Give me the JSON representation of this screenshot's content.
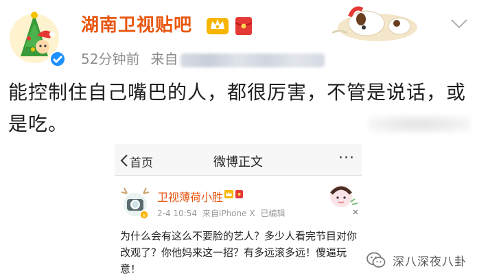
{
  "post": {
    "author": "湖南卫视贴吧",
    "time": "52分钟前",
    "source_prefix": "来自",
    "text": "能控制住自己嘴巴的人，都很厉害，不管是说话，或是吃。"
  },
  "embedded": {
    "nav": {
      "back_label": "首页",
      "title": "微博正文",
      "more": "···"
    },
    "author": "卫视薄荷小胜",
    "date": "2-4 10:54",
    "source": "来自iPhone X",
    "edited": "已编辑",
    "text": "为什么会有这么不要脸的艺人？多少人看完节目对你改观了？你他妈来这一招？有多远滚多远！傻逼玩意！"
  },
  "watermark": {
    "text": "深八深夜八卦"
  },
  "colors": {
    "author_orange": "#e8560f",
    "meta_gray": "#8d8d8d",
    "nav_bg": "#f7f7f7",
    "verified_blue": "#1e90ff"
  },
  "icons": [
    "christmas-avatar",
    "crown-badge-icon",
    "red-envelope-icon",
    "dog-decoration",
    "chevron-down-icon",
    "back-chevron-icon",
    "more-dots-icon",
    "wechat-icon"
  ]
}
